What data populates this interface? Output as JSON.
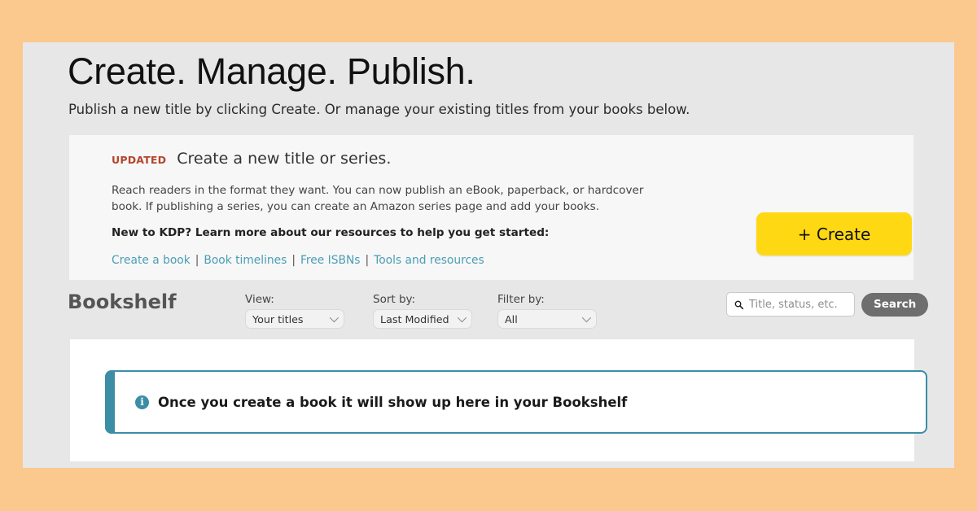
{
  "colors": {
    "outer_frame": "#FBC88D",
    "page_background": "#E7E7E8",
    "promo_card_background": "#F7F7F7",
    "create_button": "#FFD814",
    "badge_red": "#B5442F",
    "link_teal": "#4A9EB5",
    "banner_teal": "#3B8EA5",
    "search_button_gray": "#6E6E6E"
  },
  "hero": {
    "title": "Create. Manage. Publish.",
    "subtitle": "Publish a new title by clicking Create. Or manage your existing titles from your books below."
  },
  "promo": {
    "badge": "UPDATED",
    "heading": "Create a new title or series.",
    "body": "Reach readers in the format they want. You can now publish an eBook, paperback, or hardcover book. If publishing a series, you can create an Amazon series page and add your books.",
    "kdp_line": "New to KDP? Learn more about our resources to help you get started:",
    "links": [
      {
        "label": "Create a book"
      },
      {
        "label": "Book timelines"
      },
      {
        "label": "Free ISBNs"
      },
      {
        "label": "Tools and resources"
      }
    ],
    "separator": "|",
    "create_button_label": "+ Create"
  },
  "toolbar": {
    "title": "Bookshelf",
    "filters": [
      {
        "label": "View:",
        "value": "Your titles"
      },
      {
        "label": "Sort by:",
        "value": "Last Modified"
      },
      {
        "label": "Filter by:",
        "value": "All"
      }
    ],
    "search": {
      "icon": "search-icon",
      "placeholder": "Title, status, etc.",
      "value": "",
      "button_label": "Search"
    }
  },
  "shelf": {
    "banner": {
      "icon": "info-icon",
      "icon_glyph": "i",
      "message": "Once you create a book it will show up here in your Bookshelf"
    }
  }
}
